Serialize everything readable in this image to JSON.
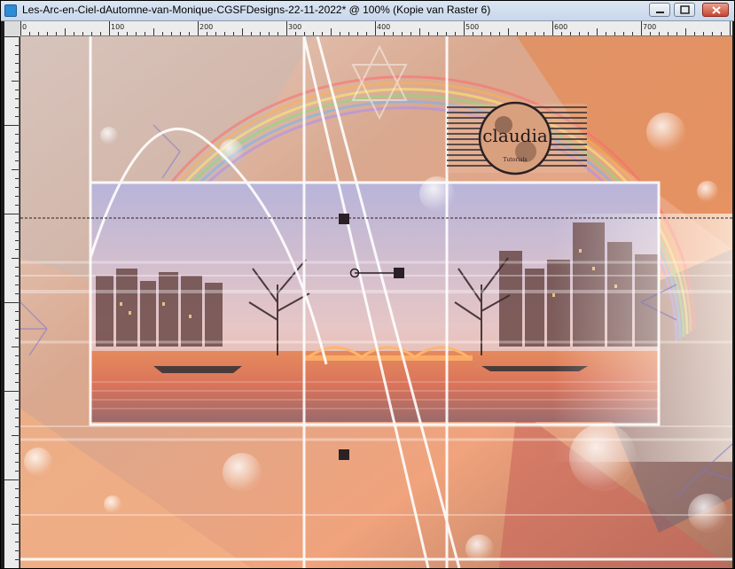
{
  "window": {
    "title": "Les-Arc-en-Ciel-dAutomne-van-Monique-CGSFDesigns-22-11-2022* @ 100% (Kopie van Raster 6)",
    "controls": [
      "minimize",
      "maximize",
      "close"
    ]
  },
  "ruler": {
    "labels": [
      "0",
      "100",
      "200",
      "300",
      "400",
      "500",
      "600",
      "700"
    ]
  },
  "watermark": {
    "name": "claudia",
    "tagline": "Tutorials"
  },
  "colors": {
    "peach": "#f0a37c",
    "cream": "#f4e7dc",
    "lavender": "#b8b4d9",
    "dark_handle": "#2a2025"
  }
}
